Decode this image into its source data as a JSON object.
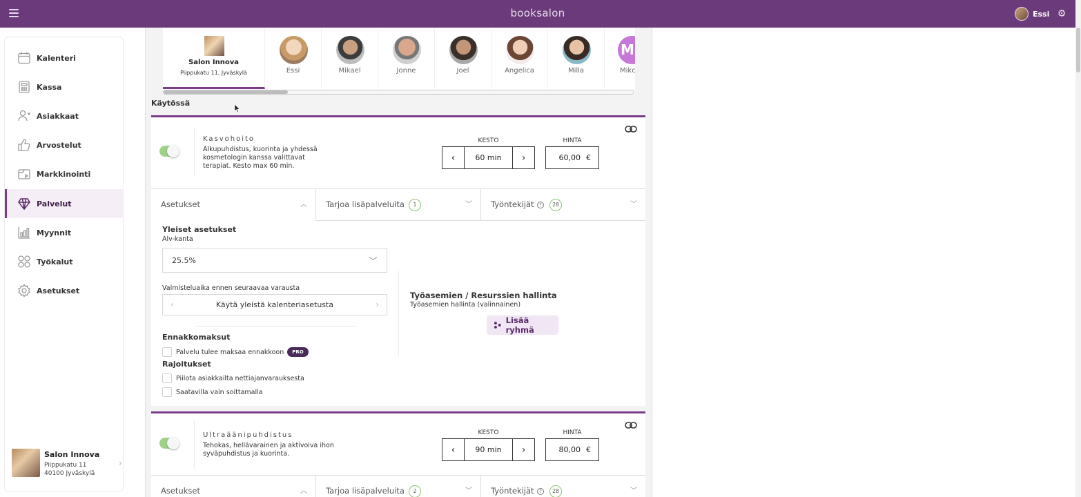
{
  "app": {
    "logo_left": "book",
    "logo_right": "salon",
    "user_name": "Essi"
  },
  "icons": {
    "menu": "hamburger-icon",
    "settings": "gear-icon",
    "link": "link-icon",
    "group": "group-icon"
  },
  "colors": {
    "brand": "#6b3a7a",
    "accent": "#7b3d8a",
    "toggle_on": "#9fd18b",
    "badge": "#8cc36f",
    "pro_badge": "#4a2a58"
  },
  "sidebar": {
    "items": [
      {
        "label": "Kalenteri",
        "icon": "calendar-icon"
      },
      {
        "label": "Kassa",
        "icon": "cash-register-icon"
      },
      {
        "label": "Asiakkaat",
        "icon": "customers-icon"
      },
      {
        "label": "Arvostelut",
        "icon": "thumbs-up-icon"
      },
      {
        "label": "Markkinointi",
        "icon": "marketing-icon"
      },
      {
        "label": "Palvelut",
        "icon": "diamond-icon",
        "active": true
      },
      {
        "label": "Myynnit",
        "icon": "bar-chart-icon"
      },
      {
        "label": "Työkalut",
        "icon": "tools-icon"
      },
      {
        "label": "Asetukset",
        "icon": "settings-icon"
      }
    ],
    "salon": {
      "name": "Salon Innova",
      "address1": "Piippukatu 11",
      "address2": "40100 Jyväskylä"
    }
  },
  "staff": {
    "salon_tab": {
      "name": "Salon Innova",
      "address": "Piippukatu 11, Jyväskylä"
    },
    "members": [
      "Essi",
      "Mikael",
      "Jonne",
      "Joel",
      "Angelica",
      "Milla",
      "Mikc"
    ],
    "last_initials": "M."
  },
  "section_label": "Käytössä",
  "services": [
    {
      "title": "Kasvohoito",
      "description": "Alkupuhdistus, kuorinta ja yhdessä kosmetologin kanssa valittavat terapiat. Kesto max 60 min.",
      "enabled": true,
      "duration_label": "KESTO",
      "duration": "60 min",
      "price_label": "HINTA",
      "price": "60,00",
      "currency": "€",
      "tabs": {
        "settings": "Asetukset",
        "addons": "Tarjoa lisäpalveluita",
        "addons_count": "1",
        "staff": "Työntekijät",
        "staff_count": "28"
      }
    },
    {
      "title": "Ultraäänipuhdistus",
      "description": "Tehokas, hellävarainen ja aktivoiva ihon syväpuhdistus ja kuorinta.",
      "enabled": true,
      "duration_label": "KESTO",
      "duration": "90 min",
      "price_label": "HINTA",
      "price": "80,00",
      "currency": "€",
      "tabs": {
        "settings": "Asetukset",
        "addons": "Tarjoa lisäpalveluita",
        "addons_count": "2",
        "staff": "Työntekijät",
        "staff_count": "28"
      }
    }
  ],
  "settings_panel": {
    "general_heading": "Yleiset asetukset",
    "vat_label": "Alv-kanta",
    "vat_value": "25.5%",
    "prep_label": "Valmisteluaika ennen seuraavaa varausta",
    "prep_value": "Käytä yleistä kalenteriasetusta",
    "prepay_heading": "Ennakkomaksut",
    "prepay_checkbox": "Palvelu tulee maksaa ennakkoon",
    "pro_badge": "PRO",
    "limits_heading": "Rajoitukset",
    "hide_checkbox": "Piilota asiakkailta nettiajanvarauksesta",
    "phone_checkbox": "Saatavilla vain soittamalla",
    "workstation_title": "Työasemien / Resurssien hallinta",
    "workstation_sub": "Työasemien hallinta (valinnainen)",
    "add_group_label": "Lisää ryhmä"
  }
}
